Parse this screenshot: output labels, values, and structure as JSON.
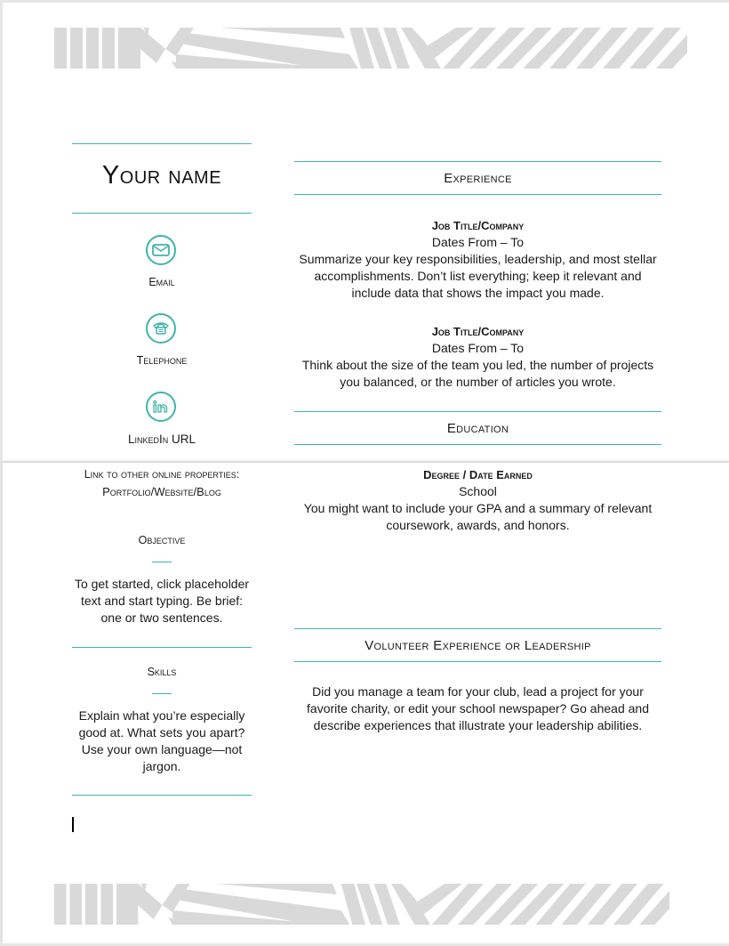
{
  "colors": {
    "accent": "#3fb4ab",
    "pattern": "#d9d9d9",
    "text": "#1a1a1a"
  },
  "header": {
    "name": "Your name"
  },
  "contact": {
    "items": [
      {
        "icon": "email-icon",
        "label": "Email"
      },
      {
        "icon": "telephone-icon",
        "label": "Telephone"
      },
      {
        "icon": "linkedin-icon",
        "label": "LinkedIn URL"
      }
    ],
    "online_properties": {
      "line1": "Link to other online properties:",
      "line2": "Portfolio/Website/Blog"
    }
  },
  "objective": {
    "heading": "Objective",
    "text": "To get started, click placeholder text and start typing. Be brief: one or two sentences."
  },
  "skills": {
    "heading": "Skills",
    "text": "Explain what you’re especially good at. What sets you apart? Use your own language—not jargon."
  },
  "experience": {
    "heading": "Experience",
    "jobs": [
      {
        "title": "Job Title/Company",
        "dates": "Dates From – To",
        "description": "Summarize your key responsibilities, leadership, and most stellar accomplishments. Don’t list everything; keep it relevant and include data that shows the impact you made."
      },
      {
        "title": "Job Title/Company",
        "dates": "Dates From – To",
        "description": "Think about the size of the team you led, the number of projects you balanced, or the number of articles you wrote."
      }
    ]
  },
  "education": {
    "heading": "Education",
    "degree": "Degree / Date Earned",
    "school": "School",
    "description": "You might want to include your GPA and a summary of relevant coursework, awards, and honors."
  },
  "volunteer": {
    "heading": "Volunteer Experience or Leadership",
    "description": "Did you manage a team for your club, lead a project for your favorite charity, or edit your school newspaper? Go ahead and describe experiences that illustrate your leadership abilities."
  }
}
